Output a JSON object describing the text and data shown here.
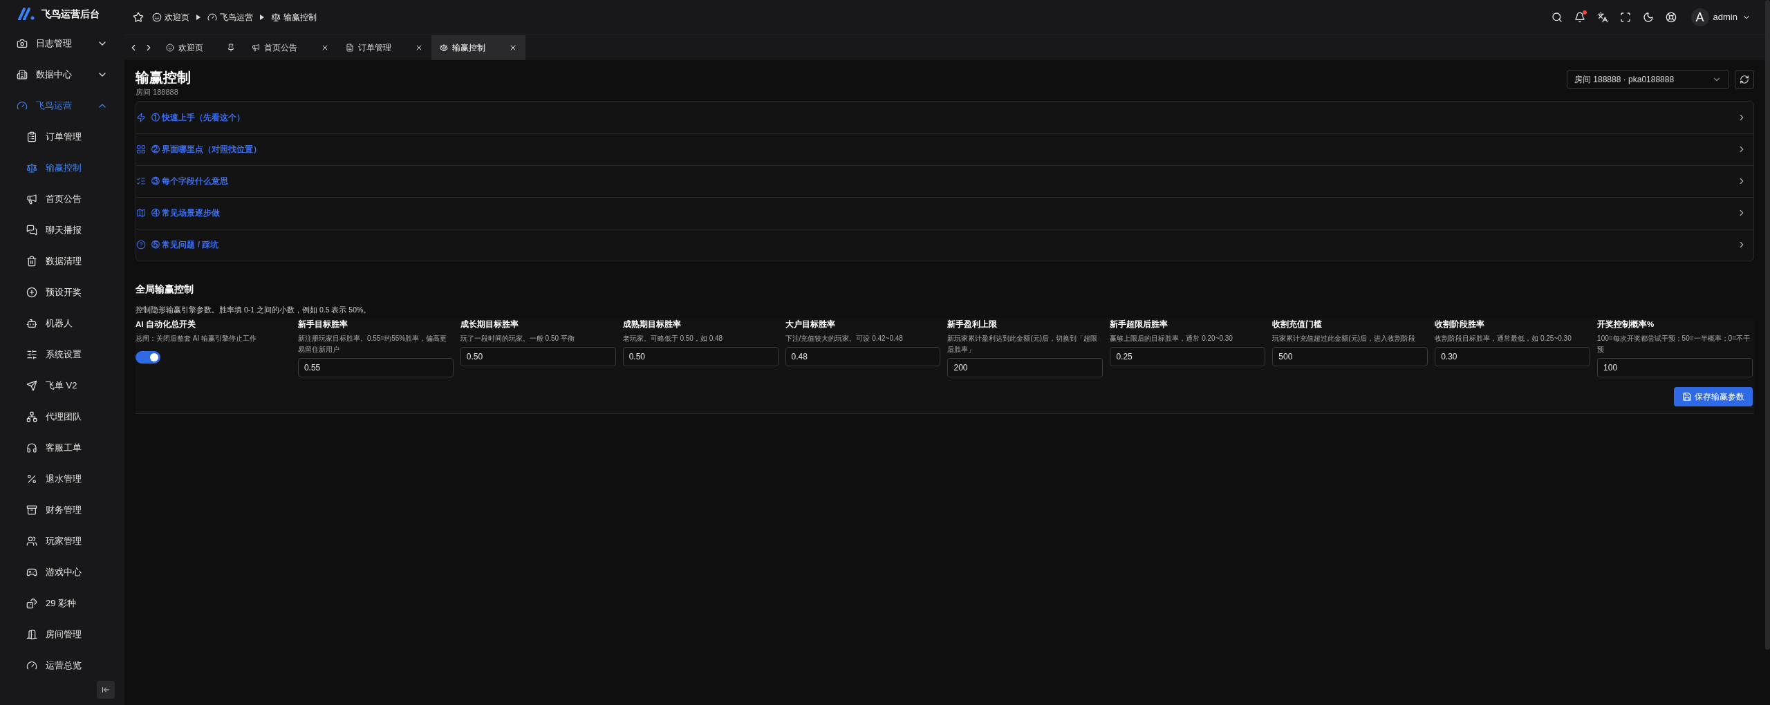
{
  "app": {
    "title": "飞鸟运营后台"
  },
  "sidebar": {
    "items": [
      {
        "label": "日志管理",
        "expanded": false
      },
      {
        "label": "数据中心",
        "expanded": false
      },
      {
        "label": "飞鸟运营",
        "expanded": true,
        "children": [
          {
            "label": "订单管理",
            "selected": false
          },
          {
            "label": "输赢控制",
            "selected": true
          },
          {
            "label": "首页公告",
            "selected": false
          },
          {
            "label": "聊天播报",
            "selected": false
          },
          {
            "label": "数据清理",
            "selected": false
          },
          {
            "label": "预设开奖",
            "selected": false
          },
          {
            "label": "机器人",
            "selected": false
          },
          {
            "label": "系统设置",
            "selected": false
          },
          {
            "label": "飞单 V2",
            "selected": false
          },
          {
            "label": "代理团队",
            "selected": false
          },
          {
            "label": "客服工单",
            "selected": false
          },
          {
            "label": "退水管理",
            "selected": false
          },
          {
            "label": "财务管理",
            "selected": false
          },
          {
            "label": "玩家管理",
            "selected": false
          },
          {
            "label": "游戏中心",
            "selected": false
          },
          {
            "label": "29 彩种",
            "selected": false
          },
          {
            "label": "房间管理",
            "selected": false
          },
          {
            "label": "运营总览",
            "selected": false
          }
        ]
      }
    ]
  },
  "breadcrumb": [
    "欢迎页",
    "飞鸟运营",
    "输赢控制"
  ],
  "header": {
    "has_unread": true,
    "avatar": "A",
    "user": "admin"
  },
  "tabs": [
    {
      "label": "欢迎页",
      "selected": false,
      "pinned": true
    },
    {
      "label": "首页公告",
      "selected": false,
      "pinned": false
    },
    {
      "label": "订单管理",
      "selected": false,
      "pinned": false
    },
    {
      "label": "输赢控制",
      "selected": true,
      "pinned": false
    }
  ],
  "page": {
    "title": "输赢控制",
    "subtitle": "房间 188888",
    "room_select": "房间 188888 · pka0188888"
  },
  "guide": [
    {
      "label": "① 快速上手（先看这个）",
      "expanded": false
    },
    {
      "label": "② 界面哪里点（对照找位置）",
      "expanded": false
    },
    {
      "label": "③ 每个字段什么意思",
      "expanded": false
    },
    {
      "label": "④ 常见场景逐步做",
      "expanded": false
    },
    {
      "label": "⑤ 常见问题 / 踩坑",
      "expanded": false
    }
  ],
  "section": {
    "title": "全局输赢控制",
    "description": "控制隐形输赢引擎参数。胜率填 0-1 之间的小数，例如 0.5 表示 50%。",
    "switch": {
      "label": "AI 自动化总开关",
      "hint": "总闸：关闭后整套 AI 输赢引擎停止工作",
      "on": true
    },
    "fields": [
      {
        "label": "新手目标胜率",
        "hint": "新注册玩家目标胜率。0.55=约55%胜率，偏高更易留住新用户",
        "value": "0.55"
      },
      {
        "label": "成长期目标胜率",
        "hint": "玩了一段时间的玩家。一般 0.50 平衡",
        "value": "0.50"
      },
      {
        "label": "成熟期目标胜率",
        "hint": "老玩家。可略低于 0.50，如 0.48",
        "value": "0.50"
      },
      {
        "label": "大户目标胜率",
        "hint": "下注/充值较大的玩家。可设 0.42~0.48",
        "value": "0.48"
      },
      {
        "label": "新手盈利上限",
        "hint": "新玩家累计盈利达到此金额(元)后，切换到「超限后胜率」",
        "value": "200"
      },
      {
        "label": "新手超限后胜率",
        "hint": "赢够上限后的目标胜率，通常 0.20~0.30",
        "value": "0.25"
      },
      {
        "label": "收割充值门槛",
        "hint": "玩家累计充值超过此金额(元)后，进入收割阶段",
        "value": "500"
      },
      {
        "label": "收割阶段胜率",
        "hint": "收割阶段目标胜率，通常最低，如 0.25~0.30",
        "value": "0.30"
      },
      {
        "label": "开奖控制概率%",
        "hint": "100=每次开奖都尝试干预；50=一半概率；0=不干预",
        "value": "100"
      }
    ],
    "save_button": "保存输赢参数"
  }
}
